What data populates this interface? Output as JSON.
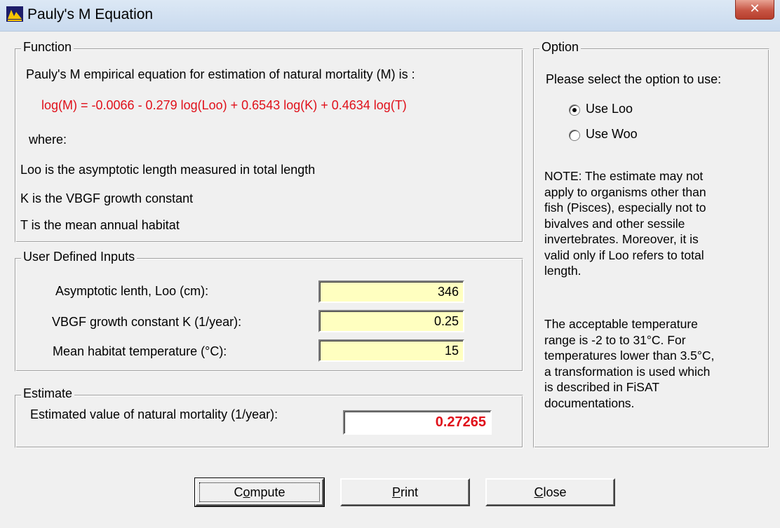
{
  "window": {
    "title": "Pauly's M Equation",
    "close_glyph": "✕"
  },
  "function": {
    "legend": "Function",
    "intro": "Pauly's M empirical equation for estimation of natural mortality (M) is :",
    "equation": "log(M) = -0.0066 - 0.279 log(Loo) + 0.6543 log(K) + 0.4634 log(T)",
    "where": "where:",
    "defs": [
      "Loo is the asymptotic length measured in total length",
      "K is the VBGF growth constant",
      "T is the mean annual habitat"
    ]
  },
  "inputs": {
    "legend": "User Defined Inputs",
    "rows": [
      {
        "label": "Asymptotic lenth, Loo (cm):",
        "value": "346"
      },
      {
        "label": "VBGF growth constant K (1/year):",
        "value": "0.25"
      },
      {
        "label": "Mean habitat temperature (°C):",
        "value": "15"
      }
    ]
  },
  "estimate": {
    "legend": "Estimate",
    "label": "Estimated value of natural mortality (1/year):",
    "value": "0.27265"
  },
  "option": {
    "legend": "Option",
    "prompt": "Please select the option to use:",
    "choices": [
      {
        "label": "Use Loo",
        "selected": true
      },
      {
        "label": "Use Woo",
        "selected": false
      }
    ],
    "note1": [
      "NOTE: The estimate may not",
      "apply to organisms other than",
      "fish (Pisces), especially not to",
      "bivalves and other sessile",
      "invertebrates. Moreover, it is",
      "valid only if Loo refers to total",
      "length."
    ],
    "note2": [
      "The acceptable temperature",
      "range is -2 to to 31°C.  For",
      "temperatures  lower  than 3.5°C,",
      "a transformation is used which",
      "is described in FiSAT",
      "documentations."
    ]
  },
  "buttons": {
    "compute": {
      "pre": "C",
      "ul": "o",
      "post": "mpute"
    },
    "print": {
      "pre": "",
      "ul": "P",
      "post": "rint"
    },
    "close": {
      "pre": "",
      "ul": "C",
      "post": "lose"
    }
  },
  "colors": {
    "equation_red": "#e0101a",
    "input_bg": "#ffffc0",
    "dialog_bg": "#f0f0f0"
  },
  "icons": {
    "app": "fisat-app-icon",
    "close": "close-icon"
  }
}
